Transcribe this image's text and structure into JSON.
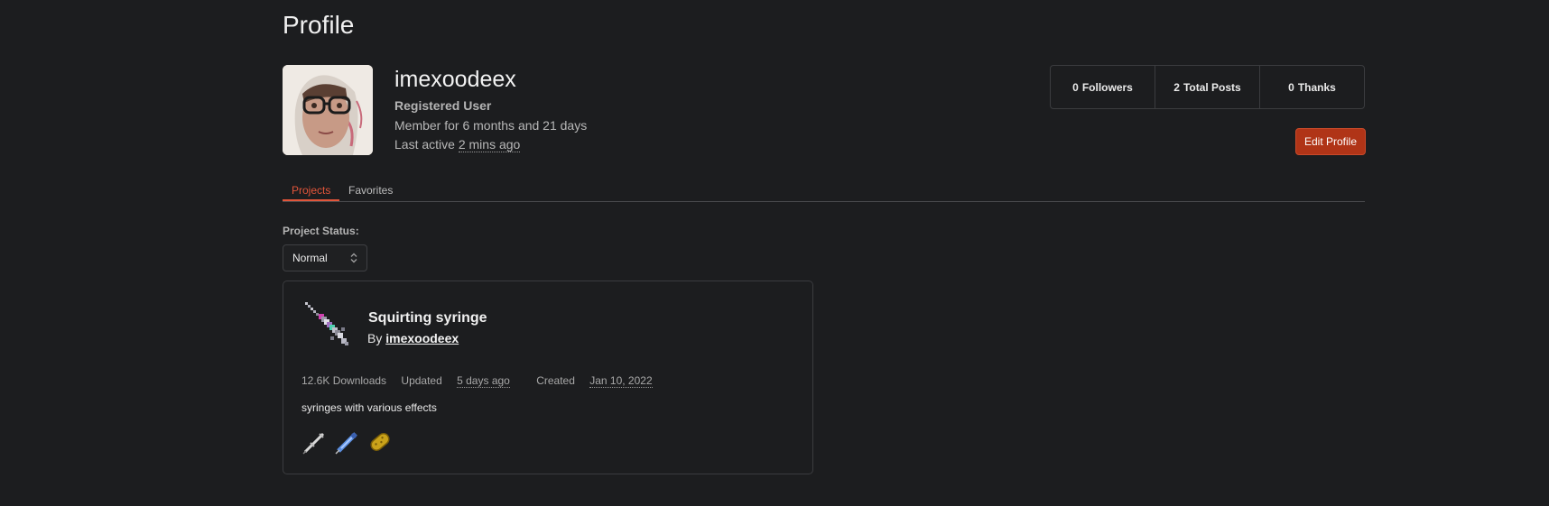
{
  "page": {
    "title": "Profile"
  },
  "user": {
    "username": "imexoodeex",
    "role": "Registered User",
    "member_text": "Member for 6 months and 21 days",
    "last_active_label": "Last active",
    "last_active_value": "2 mins ago"
  },
  "stats": [
    {
      "value": "0",
      "label": "Followers"
    },
    {
      "value": "2",
      "label": "Total Posts"
    },
    {
      "value": "0",
      "label": "Thanks"
    }
  ],
  "edit_profile_label": "Edit Profile",
  "tabs": [
    {
      "label": "Projects",
      "active": true
    },
    {
      "label": "Favorites",
      "active": false
    }
  ],
  "filter": {
    "label": "Project Status:",
    "selected": "Normal"
  },
  "project": {
    "title": "Squirting syringe",
    "by_label": "By",
    "author": "imexoodeex",
    "downloads": "12.6K Downloads",
    "updated_label": "Updated",
    "updated_value": "5 days ago",
    "created_label": "Created",
    "created_value": "Jan 10, 2022",
    "description": "syringes with various effects",
    "thumbnails": [
      "syringe-thumb-icon",
      "blue-syringe-thumb-icon",
      "golden-pill-thumb-icon"
    ]
  },
  "colors": {
    "background": "#1c1d1f",
    "accent": "#e2553a",
    "button": "#b03417"
  }
}
